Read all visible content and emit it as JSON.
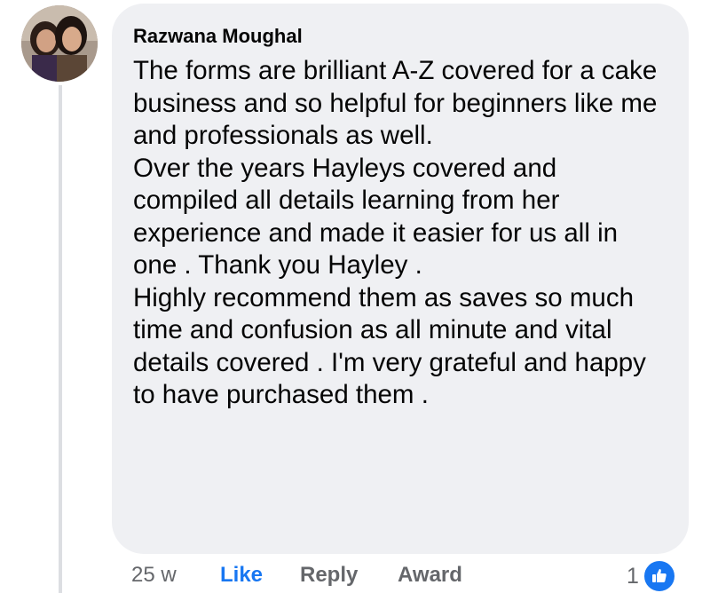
{
  "comment": {
    "author": "Razwana Moughal",
    "avatar_icon": "profile-photo",
    "paragraphs": [
      "The forms are brilliant A-Z covered for a cake business and so helpful for beginners like me and professionals as well.",
      "Over the years Hayleys covered and compiled all details learning from her experience and made it easier for us all in one . Thank you Hayley .",
      "Highly recommend them as saves so much time and confusion as all minute and vital details covered . I'm very grateful and happy to have purchased them ."
    ]
  },
  "actions": {
    "timestamp": "25 w",
    "like_label": "Like",
    "reply_label": "Reply",
    "award_label": "Award"
  },
  "reactions": {
    "count": "1",
    "icon": "thumbs-up-icon"
  },
  "colors": {
    "bubble_bg": "#eff0f3",
    "link_blue": "#1877f2",
    "secondary_text": "#65676b",
    "primary_text": "#050505"
  }
}
